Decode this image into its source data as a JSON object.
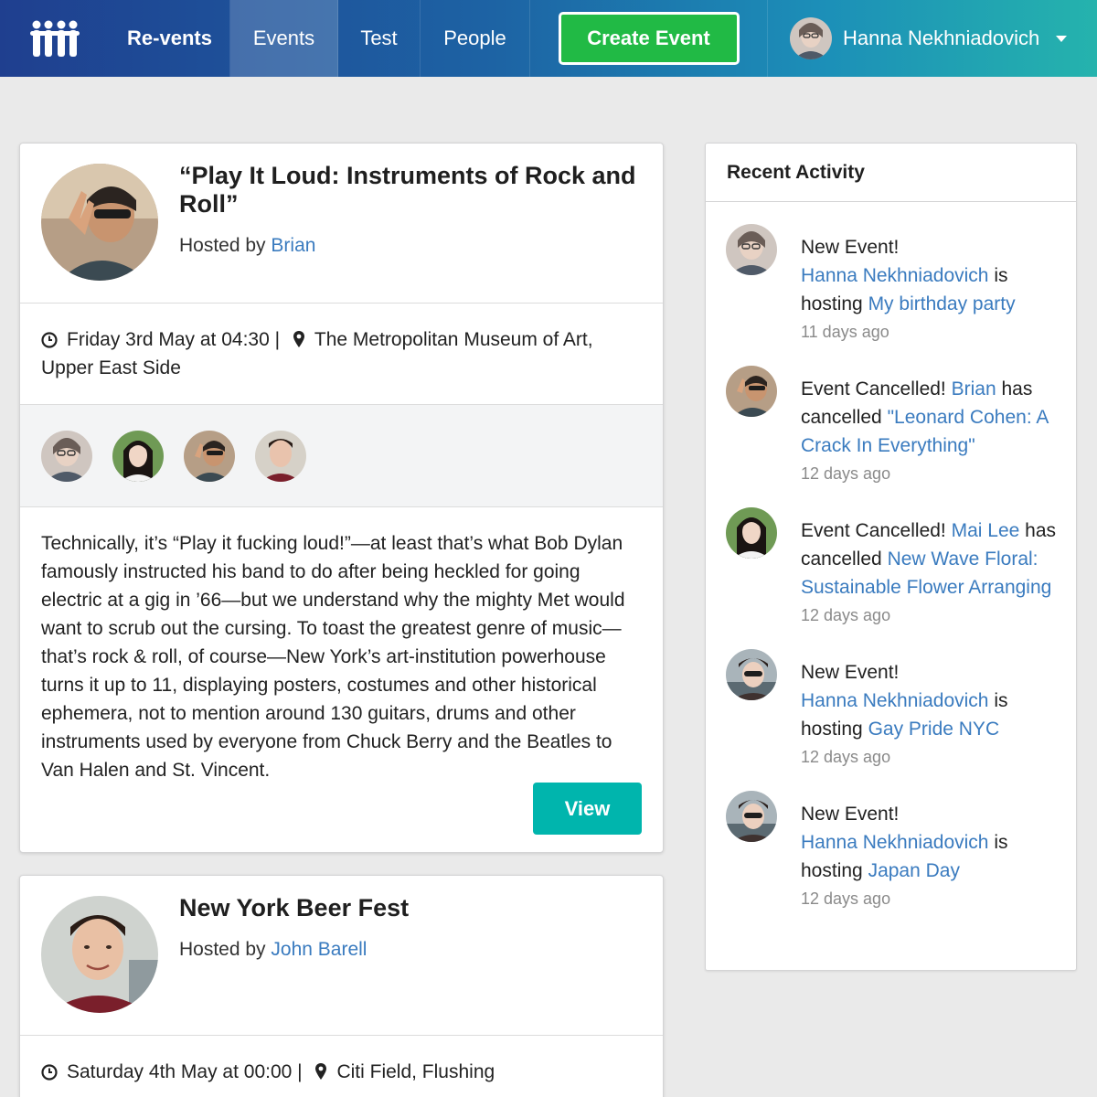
{
  "nav": {
    "brand": "Re-vents",
    "items": [
      {
        "label": "Events",
        "active": true
      },
      {
        "label": "Test",
        "active": false
      },
      {
        "label": "People",
        "active": false
      }
    ],
    "create_label": "Create Event",
    "user_name": "Hanna Nekhniadovich",
    "logo_icon": "people-group-icon"
  },
  "events": [
    {
      "title": "“Play It Loud: Instruments of Rock and Roll”",
      "hosted_by_label": "Hosted by",
      "host": "Brian",
      "date": "Friday 3rd May at 04:30 |",
      "venue": "The Metropolitan Museum of Art, Upper East Side",
      "description": "Technically, it’s “Play it fucking loud!”—at least that’s what Bob Dylan famously instructed his band to do after being heckled for going electric at a gig in ’66—but we understand why the mighty Met would want to scrub out the cursing. To toast the greatest genre of music—that’s rock & roll, of course—New York’s art-institution powerhouse turns it up to 11, displaying posters, costumes and other historical ephemera, not to mention around 130 guitars, drums and other instruments used by everyone from Chuck Berry and the Beatles to Van Halen and St. Vincent.",
      "view_label": "View"
    },
    {
      "title": "New York Beer Fest",
      "hosted_by_label": "Hosted by",
      "host": "John Barell",
      "date": "Saturday 4th May at 00:00 |",
      "venue": "Citi Field, Flushing"
    }
  ],
  "activity": {
    "title": "Recent Activity",
    "items": [
      {
        "label": "New Event!",
        "name": "Hanna Nekhniadovich",
        "mid": "is hosting",
        "event": "My birthday party",
        "time": "11 days ago"
      },
      {
        "label": "Event Cancelled!",
        "name": "Brian",
        "mid": "has cancelled",
        "event": "\"Leonard Cohen: A Crack In Everything\"",
        "time": "12 days ago"
      },
      {
        "label": "Event Cancelled!",
        "name": "Mai Lee",
        "mid": "has cancelled",
        "event": "New Wave Floral: Sustainable Flower Arranging",
        "time": "12 days ago"
      },
      {
        "label": "New Event!",
        "name": "Hanna Nekhniadovich",
        "mid": "is hosting",
        "event": "Gay Pride NYC",
        "time": "12 days ago"
      },
      {
        "label": "New Event!",
        "name": "Hanna Nekhniadovich",
        "mid": "is hosting",
        "event": "Japan Day",
        "time": "12 days ago"
      }
    ]
  },
  "colors": {
    "accent_green": "#21ba45",
    "accent_teal": "#00b5ad",
    "link": "#3a7bbf"
  }
}
